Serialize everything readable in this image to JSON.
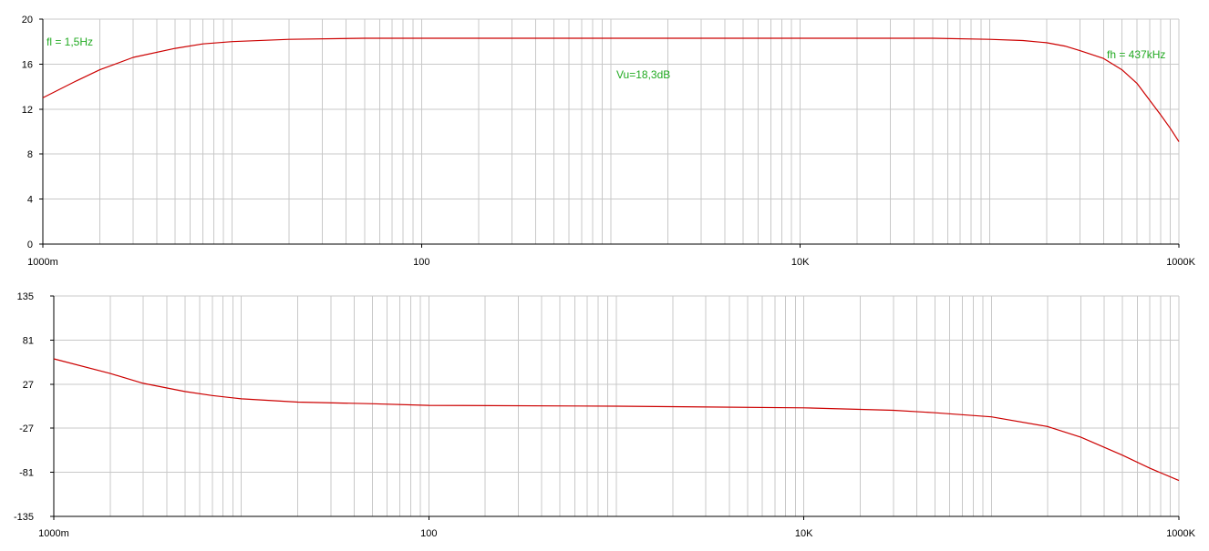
{
  "colors": {
    "trace": "#cc0000",
    "grid": "#c8c8c8",
    "axis": "#000000",
    "annotation": "#22aa22",
    "background": "#ffffff"
  },
  "chart_data": [
    {
      "type": "line",
      "xscale": "log",
      "xlim": [
        1,
        1000000
      ],
      "ylim": [
        0,
        20
      ],
      "grid": true,
      "x_tick_labels": [
        "1000m",
        "100",
        "10K",
        "1000K"
      ],
      "y_ticks": [
        0,
        4,
        8,
        12,
        16,
        20
      ],
      "series": [
        {
          "x": [
            1,
            1.5,
            2,
            3,
            5,
            7,
            10,
            20,
            50,
            100,
            1000,
            10000,
            50000,
            100000,
            150000,
            200000,
            250000,
            300000,
            400000,
            500000,
            600000,
            700000,
            800000,
            900000,
            1000000
          ],
          "values": [
            13.0,
            14.5,
            15.5,
            16.6,
            17.4,
            17.8,
            18.0,
            18.2,
            18.3,
            18.3,
            18.3,
            18.3,
            18.3,
            18.2,
            18.1,
            17.9,
            17.6,
            17.2,
            16.5,
            15.5,
            14.3,
            12.8,
            11.5,
            10.3,
            9.1
          ]
        }
      ],
      "annotations": [
        "fl = 1,5Hz",
        "Vu=18,3dB",
        "fh = 437kHz"
      ]
    },
    {
      "type": "line",
      "xscale": "log",
      "xlim": [
        1,
        1000000
      ],
      "ylim": [
        -135,
        135
      ],
      "grid": true,
      "x_tick_labels": [
        "1000m",
        "100",
        "10K",
        "1000K"
      ],
      "y_ticks": [
        135,
        81,
        27,
        -27,
        -81,
        -135
      ],
      "series": [
        {
          "x": [
            1,
            2,
            3,
            5,
            7,
            10,
            20,
            50,
            100,
            1000,
            10000,
            30000,
            50000,
            100000,
            200000,
            300000,
            500000,
            700000,
            1000000
          ],
          "values": [
            58,
            40,
            28,
            18,
            13,
            9,
            5,
            3,
            1,
            0,
            -2,
            -5,
            -8,
            -13,
            -25,
            -38,
            -60,
            -76,
            -91
          ]
        }
      ]
    }
  ]
}
